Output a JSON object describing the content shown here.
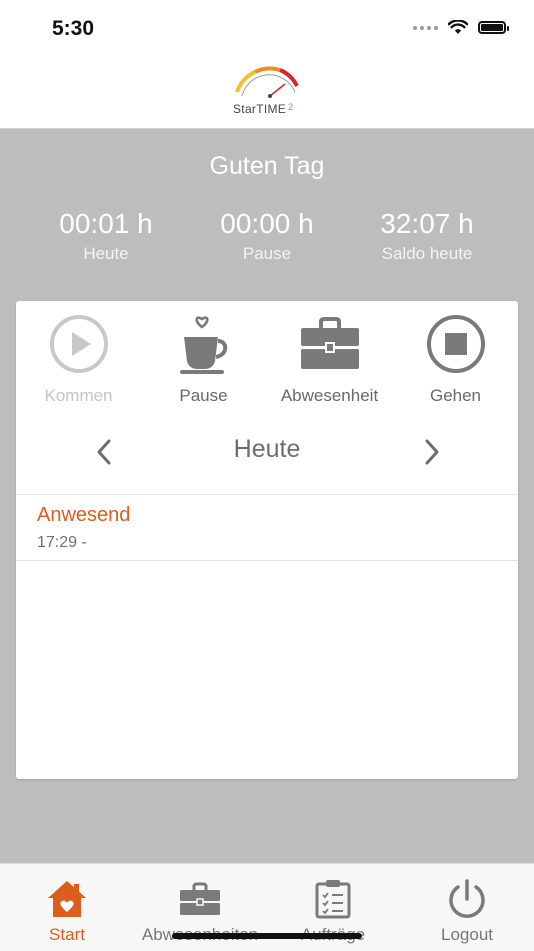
{
  "status_bar": {
    "time": "5:30"
  },
  "header": {
    "logo_text": "StarTIME",
    "logo_version": "2"
  },
  "greeting": "Guten Tag",
  "stats": [
    {
      "value": "00:01 h",
      "label": "Heute"
    },
    {
      "value": "00:00 h",
      "label": "Pause"
    },
    {
      "value": "32:07 h",
      "label": "Saldo heute"
    }
  ],
  "actions": {
    "kommen": {
      "label": "Kommen",
      "icon": "play-circle-icon",
      "enabled": false
    },
    "pause": {
      "label": "Pause",
      "icon": "coffee-cup-icon"
    },
    "abwesenheit": {
      "label": "Abwesenheit",
      "icon": "briefcase-icon"
    },
    "gehen": {
      "label": "Gehen",
      "icon": "stop-circle-icon"
    }
  },
  "day_nav": {
    "label": "Heute"
  },
  "entry": {
    "status": "Anwesend",
    "time": "17:29 -"
  },
  "colors": {
    "accent": "#dc5d1e",
    "background": "#bdbdbd",
    "icon_gray": "#7a7a7a"
  },
  "tabs": [
    {
      "label": "Start",
      "icon": "home-icon",
      "active": true
    },
    {
      "label": "Abwesenheiten",
      "icon": "briefcase-icon"
    },
    {
      "label": "Aufträge",
      "icon": "clipboard-checklist-icon"
    },
    {
      "label": "Logout",
      "icon": "power-icon"
    }
  ]
}
